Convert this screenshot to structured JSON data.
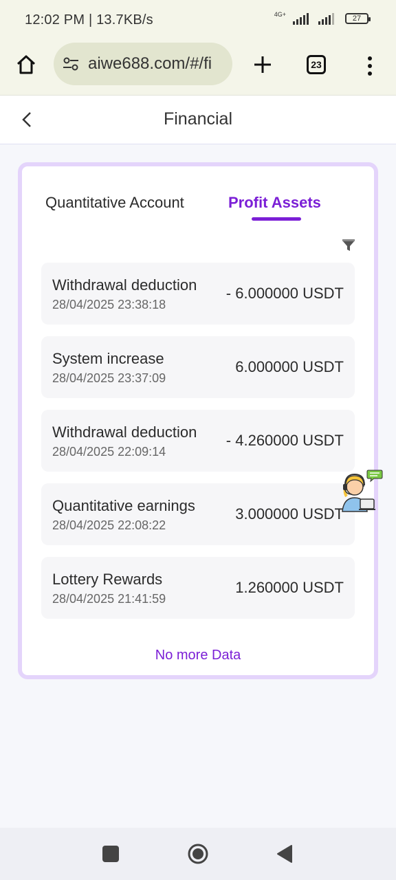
{
  "status_bar": {
    "time": "12:02 PM | 13.7KB/s",
    "network": "4G+",
    "battery": "27"
  },
  "browser": {
    "url": "aiwe688.com/#/fi",
    "tab_count": "23"
  },
  "header": {
    "title": "Financial"
  },
  "tabs": [
    {
      "label": "Quantitative Account",
      "active": false
    },
    {
      "label": "Profit Assets",
      "active": true
    }
  ],
  "records": [
    {
      "title": "Withdrawal deduction",
      "time": "28/04/2025 23:38:18",
      "amount": "- 6.000000 USDT"
    },
    {
      "title": "System increase",
      "time": "28/04/2025 23:37:09",
      "amount": "6.000000 USDT"
    },
    {
      "title": "Withdrawal deduction",
      "time": "28/04/2025 22:09:14",
      "amount": "- 4.260000 USDT"
    },
    {
      "title": "Quantitative earnings",
      "time": "28/04/2025 22:08:22",
      "amount": "3.000000 USDT"
    },
    {
      "title": "Lottery Rewards",
      "time": "28/04/2025 21:41:59",
      "amount": "1.260000 USDT"
    }
  ],
  "footer": {
    "no_more": "No more Data"
  },
  "icons": {
    "home": "home-icon",
    "tune": "tune-icon",
    "plus": "plus-icon",
    "tabs": "tabs-icon",
    "menu": "more-vert-icon",
    "back": "chevron-left-icon",
    "filter": "filter-icon",
    "support": "customer-support-icon",
    "nav_recents": "recents-icon",
    "nav_home": "nav-home-icon",
    "nav_back": "nav-back-icon"
  },
  "colors": {
    "accent": "#7b1fd6",
    "card_border": "#e4d4fb",
    "browser_bg": "#f4f5e9"
  }
}
